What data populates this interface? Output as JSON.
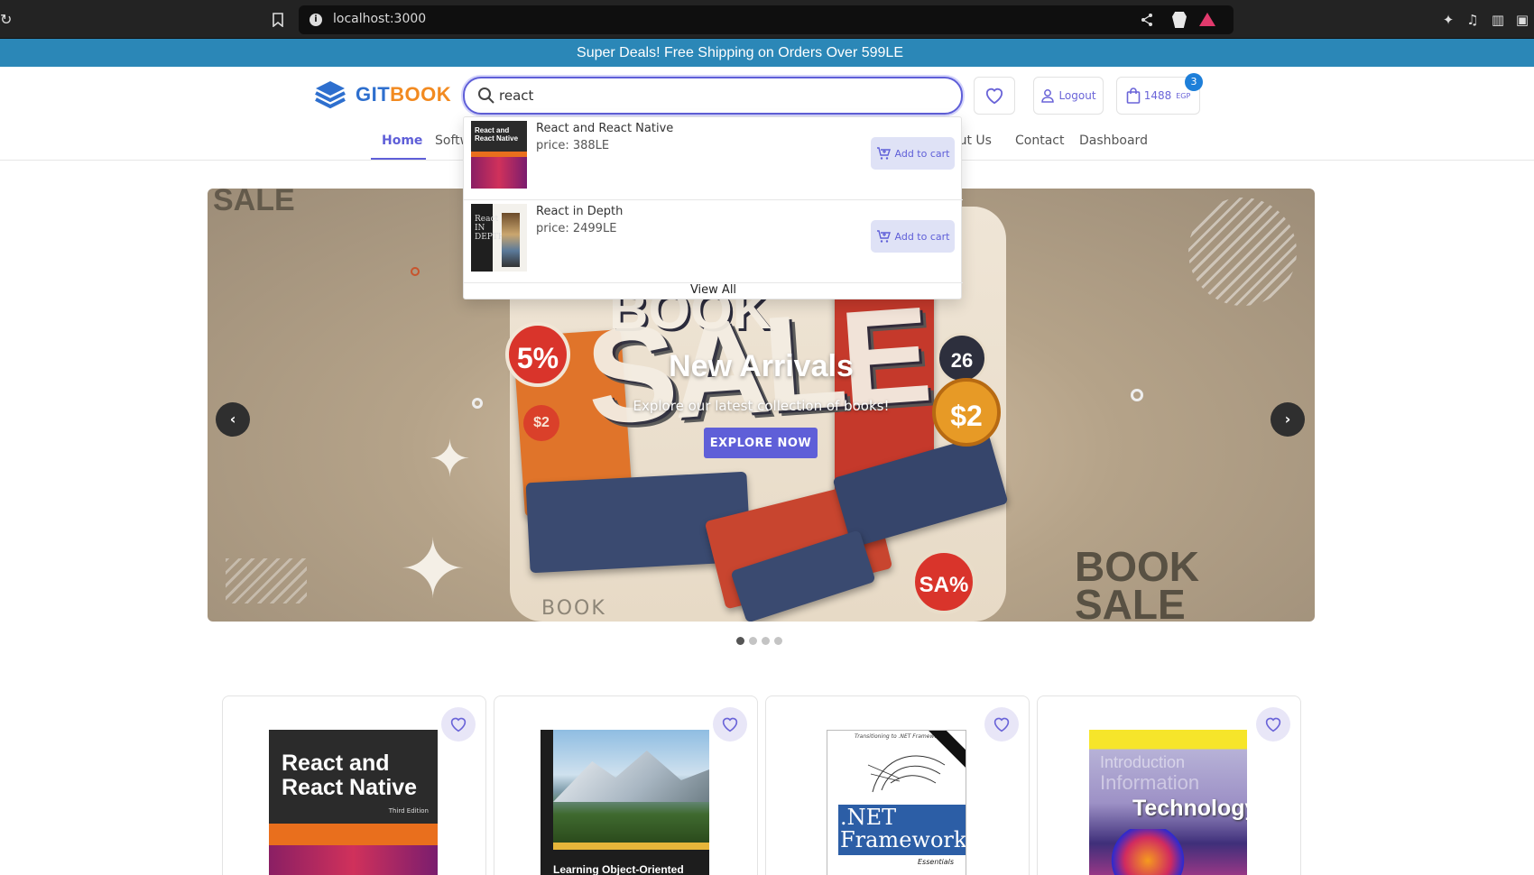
{
  "browser": {
    "url": "localhost:3000"
  },
  "promo": {
    "text": "Super Deals! Free Shipping on Orders Over 599LE"
  },
  "header": {
    "logo": {
      "part1": "GIT",
      "part2": "BOOK"
    },
    "search": {
      "value": "react",
      "placeholder": ""
    },
    "wishlist_icon": "heart-icon",
    "logout_label": "Logout",
    "cart": {
      "total": "1488",
      "currency": "EGP",
      "count": "3"
    }
  },
  "nav": {
    "items": [
      {
        "label": "Home",
        "active": true
      },
      {
        "label": "Softw"
      },
      {
        "label": "out Us"
      },
      {
        "label": "Contact"
      },
      {
        "label": "Dashboard"
      }
    ]
  },
  "search_results": {
    "items": [
      {
        "name": "React and React Native",
        "price": "price: 388LE",
        "button": "Add to cart",
        "cover_title": "React and React Native"
      },
      {
        "name": "React in Depth",
        "price": "price: 2499LE",
        "button": "Add to cart",
        "cover_title": "React IN DEPTH"
      }
    ],
    "view_all": "View All"
  },
  "hero": {
    "title": "New Arrivals",
    "subtitle": "Explore our latest collection of books!",
    "button": "EXPLORE NOW",
    "bg_texts": {
      "sale_corner": "SALE",
      "book_sale": "BOOK SALE",
      "big": "SALE",
      "book_top": "BOOK",
      "badge": "5%",
      "faint": "BOOK",
      "coin_a": "26",
      "coin_b": "$2",
      "coin_c": "SA%",
      "coin_d": "$2",
      "spine": "BOOK SALE"
    },
    "slides": 4,
    "active_slide": 1
  },
  "products": [
    {
      "title": "React and React Native",
      "edition": "Third Edition"
    },
    {
      "title": "Learning Object-Oriented"
    },
    {
      "title": ".NET Framework",
      "top": "Transitioning to .NET Framework",
      "subtitle": "Essentials"
    },
    {
      "title_lines": [
        "Introduction",
        "Information",
        "Technology"
      ]
    }
  ],
  "colors": {
    "accent": "#5f5fd8",
    "promo_bg": "#2b87b7",
    "badge": "#1e7fd9",
    "logo_blue": "#2e6fce",
    "logo_orange": "#f28a20"
  }
}
